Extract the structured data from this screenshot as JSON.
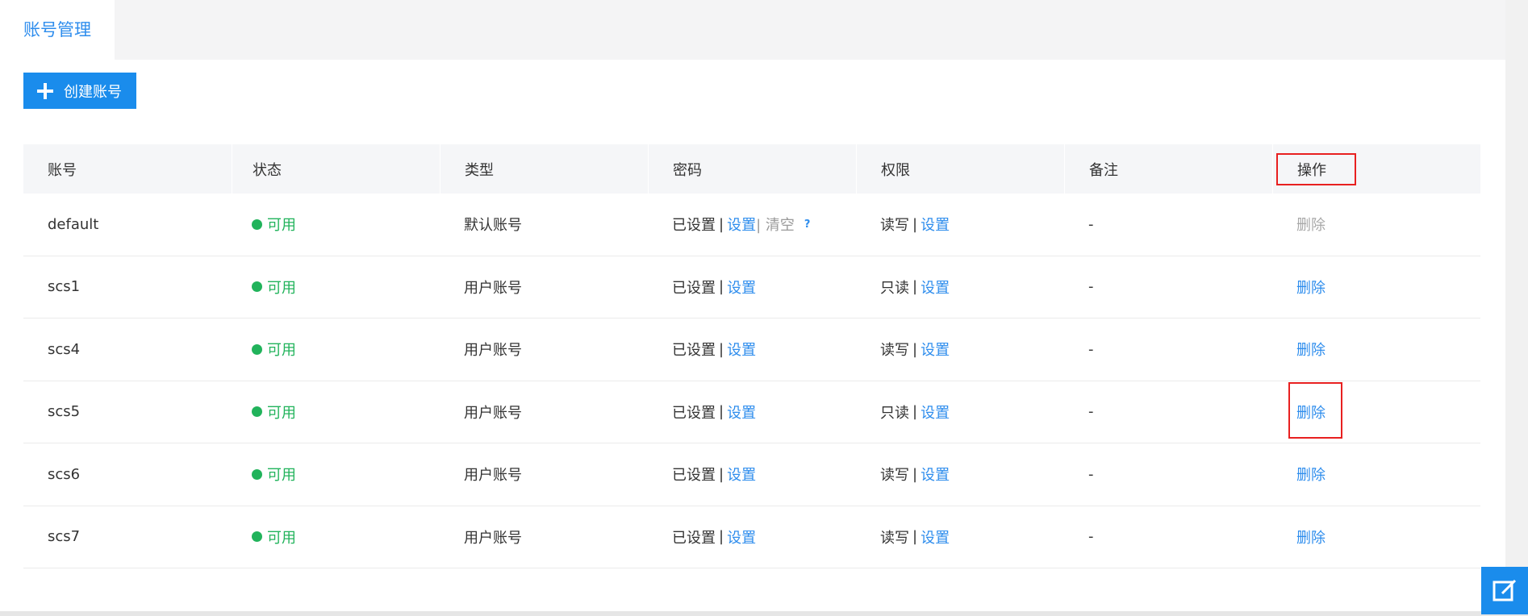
{
  "tabs": [
    {
      "label": "账号管理"
    }
  ],
  "toolbar": {
    "create_label": "创建账号"
  },
  "table": {
    "headers": [
      "账号",
      "状态",
      "类型",
      "密码",
      "权限",
      "备注",
      "操作"
    ],
    "rows": [
      {
        "account": "default",
        "status": "可用",
        "type": "默认账号",
        "password_state": "已设置",
        "password_sep": "|",
        "password_set": "设置",
        "password_clear": "| 清空",
        "password_help": "?",
        "permission": "读写",
        "permission_sep": "|",
        "permission_set": "设置",
        "remark": "-",
        "action": "删除",
        "action_enabled": false
      },
      {
        "account": "scs1",
        "status": "可用",
        "type": "用户账号",
        "password_state": "已设置",
        "password_sep": "|",
        "password_set": "设置",
        "permission": "只读",
        "permission_sep": "|",
        "permission_set": "设置",
        "remark": "-",
        "action": "删除",
        "action_enabled": true
      },
      {
        "account": "scs4",
        "status": "可用",
        "type": "用户账号",
        "password_state": "已设置",
        "password_sep": "|",
        "password_set": "设置",
        "permission": "读写",
        "permission_sep": "|",
        "permission_set": "设置",
        "remark": "-",
        "action": "删除",
        "action_enabled": true
      },
      {
        "account": "scs5",
        "status": "可用",
        "type": "用户账号",
        "password_state": "已设置",
        "password_sep": "|",
        "password_set": "设置",
        "permission": "只读",
        "permission_sep": "|",
        "permission_set": "设置",
        "remark": "-",
        "action": "删除",
        "action_enabled": true
      },
      {
        "account": "scs6",
        "status": "可用",
        "type": "用户账号",
        "password_state": "已设置",
        "password_sep": "|",
        "password_set": "设置",
        "permission": "读写",
        "permission_sep": "|",
        "permission_set": "设置",
        "remark": "-",
        "action": "删除",
        "action_enabled": true
      },
      {
        "account": "scs7",
        "status": "可用",
        "type": "用户账号",
        "password_state": "已设置",
        "password_sep": "|",
        "password_set": "设置",
        "permission": "读写",
        "permission_sep": "|",
        "permission_set": "设置",
        "remark": "-",
        "action": "删除",
        "action_enabled": true
      }
    ]
  },
  "icons": {
    "create": "plus-icon",
    "status": "status-dot-icon",
    "help": "help-icon",
    "float": "edit-icon"
  },
  "colors": {
    "primary": "#1a8cec",
    "link": "#2e8ded",
    "success": "#21b35b",
    "highlight": "#e82020"
  }
}
